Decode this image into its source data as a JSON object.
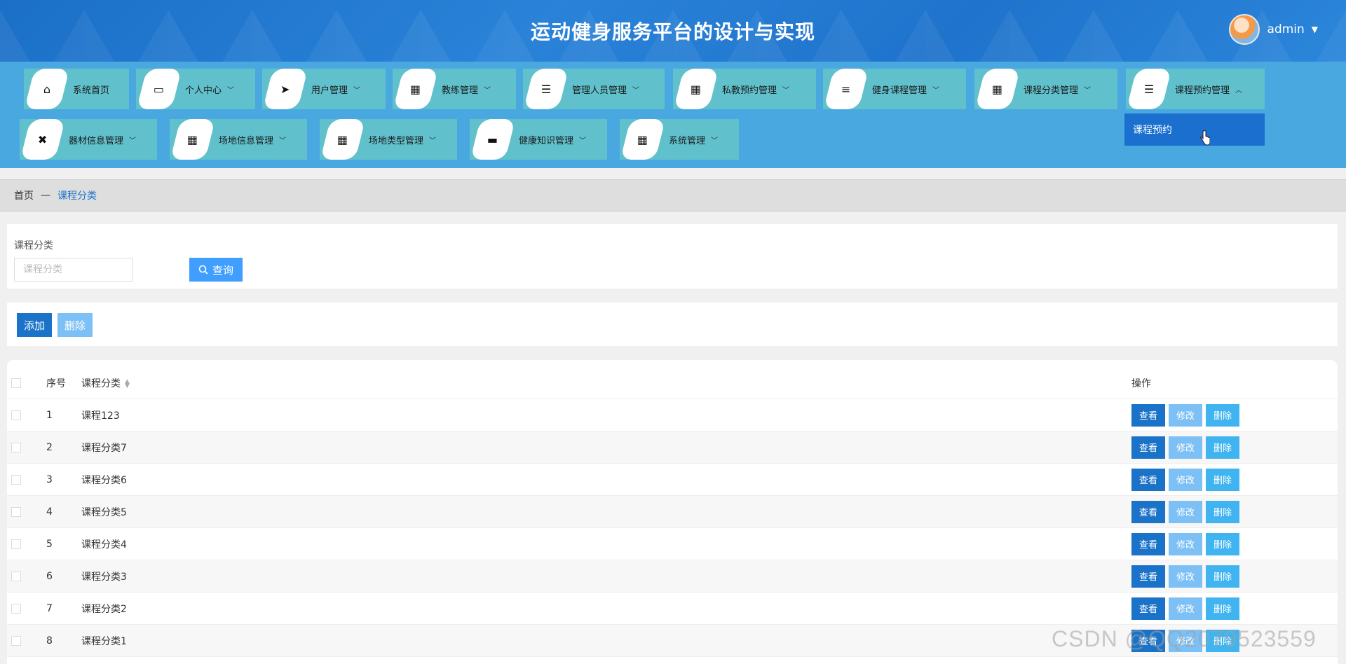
{
  "header": {
    "title": "运动健身服务平台的设计与实现",
    "user_name": "admin",
    "caret": "▼"
  },
  "nav": {
    "items": [
      {
        "label": "系统首页",
        "icon": "home-icon",
        "glyph": "⌂",
        "chevron": ""
      },
      {
        "label": "个人中心",
        "icon": "wallet-icon",
        "glyph": "▭",
        "chevron": "﹀"
      },
      {
        "label": "用户管理",
        "icon": "send-icon",
        "glyph": "➤",
        "chevron": "﹀"
      },
      {
        "label": "教练管理",
        "icon": "grid-icon",
        "glyph": "▦",
        "chevron": "﹀"
      },
      {
        "label": "管理人员管理",
        "icon": "sliders-icon",
        "glyph": "☰",
        "chevron": "﹀"
      },
      {
        "label": "私教预约管理",
        "icon": "grid-icon",
        "glyph": "▦",
        "chevron": "﹀"
      },
      {
        "label": "健身课程管理",
        "icon": "list-icon",
        "glyph": "≡",
        "chevron": "﹀"
      },
      {
        "label": "课程分类管理",
        "icon": "grid-icon",
        "glyph": "▦",
        "chevron": "﹀"
      },
      {
        "label": "课程预约管理",
        "icon": "list-indent-icon",
        "glyph": "☰",
        "chevron": "︿"
      },
      {
        "label": "器材信息管理",
        "icon": "dumbbell-icon",
        "glyph": "✖",
        "chevron": "﹀"
      },
      {
        "label": "场地信息管理",
        "icon": "grid-icon",
        "glyph": "▦",
        "chevron": "﹀"
      },
      {
        "label": "场地类型管理",
        "icon": "grid-icon",
        "glyph": "▦",
        "chevron": "﹀"
      },
      {
        "label": "健康知识管理",
        "icon": "archive-icon",
        "glyph": "▬",
        "chevron": "﹀"
      },
      {
        "label": "系统管理",
        "icon": "grid-icon",
        "glyph": "▦",
        "chevron": "﹀"
      }
    ],
    "dropdown_item": "课程预约"
  },
  "breadcrumb": {
    "home": "首页",
    "sep": "—",
    "current": "课程分类"
  },
  "search": {
    "label": "课程分类",
    "placeholder": "课程分类",
    "button": "查询"
  },
  "actions": {
    "add": "添加",
    "delete": "删除"
  },
  "table": {
    "headers": {
      "index": "序号",
      "name": "课程分类",
      "ops": "操作"
    },
    "rows": [
      {
        "index": "1",
        "name": "课程123"
      },
      {
        "index": "2",
        "name": "课程分类7"
      },
      {
        "index": "3",
        "name": "课程分类6"
      },
      {
        "index": "4",
        "name": "课程分类5"
      },
      {
        "index": "5",
        "name": "课程分类4"
      },
      {
        "index": "6",
        "name": "课程分类3"
      },
      {
        "index": "7",
        "name": "课程分类2"
      },
      {
        "index": "8",
        "name": "课程分类1"
      }
    ],
    "op_labels": {
      "view": "查看",
      "edit": "修改",
      "delete": "删除"
    }
  },
  "watermark": "CSDN @QQ2079523559",
  "colors": {
    "header_bg": "#1b6fc7",
    "nav_bg": "#4aa8e0",
    "nav_item_bg": "#60c0cc",
    "primary": "#1a73c8",
    "light_blue": "#7cc0f5"
  }
}
